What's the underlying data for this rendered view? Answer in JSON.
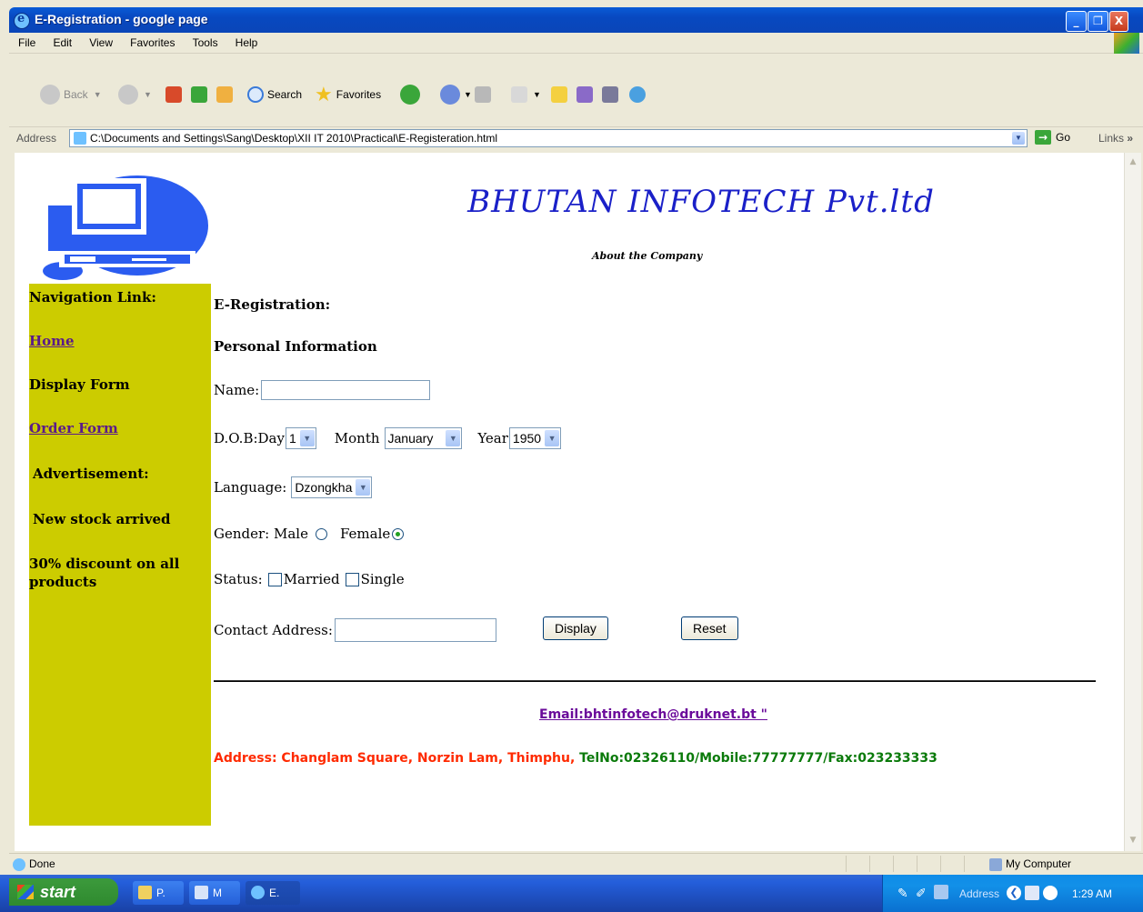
{
  "window": {
    "title": "E-Registration - google page",
    "min_glyph": "_",
    "max_glyph": "❐",
    "close_glyph": "X"
  },
  "menu": [
    "File",
    "Edit",
    "View",
    "Favorites",
    "Tools",
    "Help"
  ],
  "toolbar": {
    "back_label": "Back",
    "search_label": "Search",
    "favorites_label": "Favorites"
  },
  "address_bar": {
    "label": "Address",
    "url": "C:\\Documents and Settings\\Sang\\Desktop\\XII IT 2010\\Practical\\E-Registeration.html",
    "go_label": "Go",
    "links_label": "Links"
  },
  "page": {
    "company_name": "BHUTAN INFOTECH Pvt.ltd",
    "about": "About the Company",
    "sidebar": {
      "heading": "Navigation Link:",
      "home": "Home",
      "display_form": "Display Form",
      "order_form": "Order Form",
      "advertisement": "Advertisement:",
      "ad_line1": "New stock arrived",
      "ad_line2": "30% discount on all products"
    },
    "form": {
      "heading": "E-Registration:",
      "section": "Personal Information",
      "name_label": "Name:",
      "name_value": "",
      "dob_label": "D.O.B:Day",
      "day_value": "1",
      "month_label": "Month",
      "month_value": "January",
      "year_label": "Year",
      "year_value": "1950",
      "language_label": "Language:",
      "language_value": "Dzongkha",
      "gender_label": "Gender: Male",
      "gender_female": "Female",
      "gender_selected": "Female",
      "status_label": "Status:",
      "status_married": "Married",
      "status_single": "Single",
      "contact_label": "Contact Address:",
      "contact_value": "",
      "display_button": "Display",
      "reset_button": "Reset"
    },
    "footer": {
      "email": "Email:bhtinfotech@druknet.bt \"",
      "address_part1": "Address: Changlam Square, Norzin Lam, Thimphu, ",
      "address_part2": "TelNo:02326110/Mobile:77777777/Fax:023233333"
    }
  },
  "status_bar": {
    "status": "Done",
    "zone": "My Computer"
  },
  "taskbar": {
    "start_label": "start",
    "tasks": [
      "P.",
      "M",
      "E."
    ],
    "tray_address_label": "Address",
    "clock": "1:29 AM"
  },
  "colors": {
    "sidebar_bg": "#cccc00",
    "company_name": "#1a20c8",
    "link_visited": "#5a1a8a",
    "address_red": "#ff2a00",
    "address_green": "#0a7a0a"
  }
}
